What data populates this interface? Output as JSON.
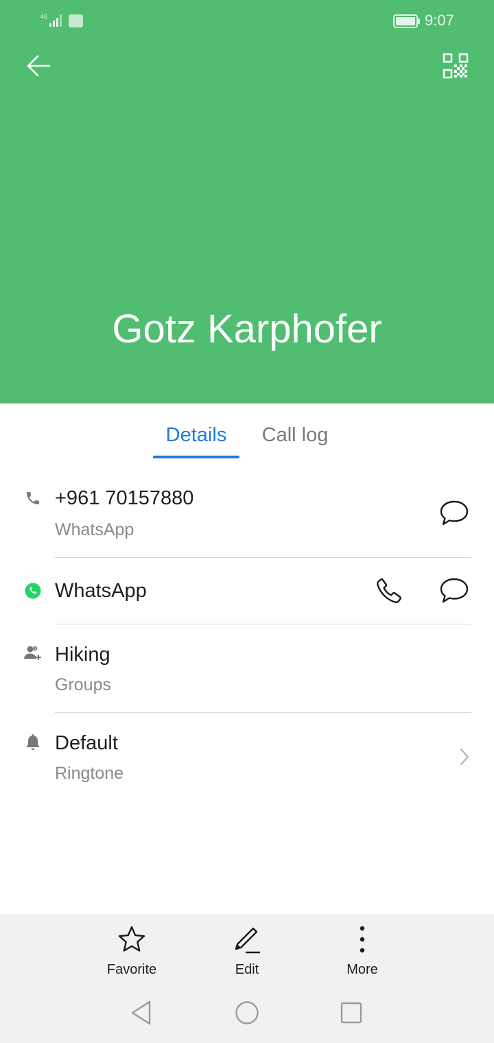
{
  "status_bar": {
    "network": "4G",
    "time": "9:07"
  },
  "header": {
    "contact_name": "Gotz Karphofer",
    "color": "#50BD70"
  },
  "tabs": [
    {
      "label": "Details",
      "active": true
    },
    {
      "label": "Call log",
      "active": false
    }
  ],
  "details": {
    "phone": {
      "number": "+961 70157880",
      "label": "WhatsApp"
    },
    "whatsapp": {
      "label": "WhatsApp"
    },
    "groups": {
      "value": "Hiking",
      "label": "Groups"
    },
    "ringtone": {
      "value": "Default",
      "label": "Ringtone"
    }
  },
  "bottom_bar": {
    "favorite": "Favorite",
    "edit": "Edit",
    "more": "More"
  },
  "colors": {
    "accent": "#1E7BE0",
    "header": "#50BD70",
    "whatsapp": "#25D366"
  }
}
